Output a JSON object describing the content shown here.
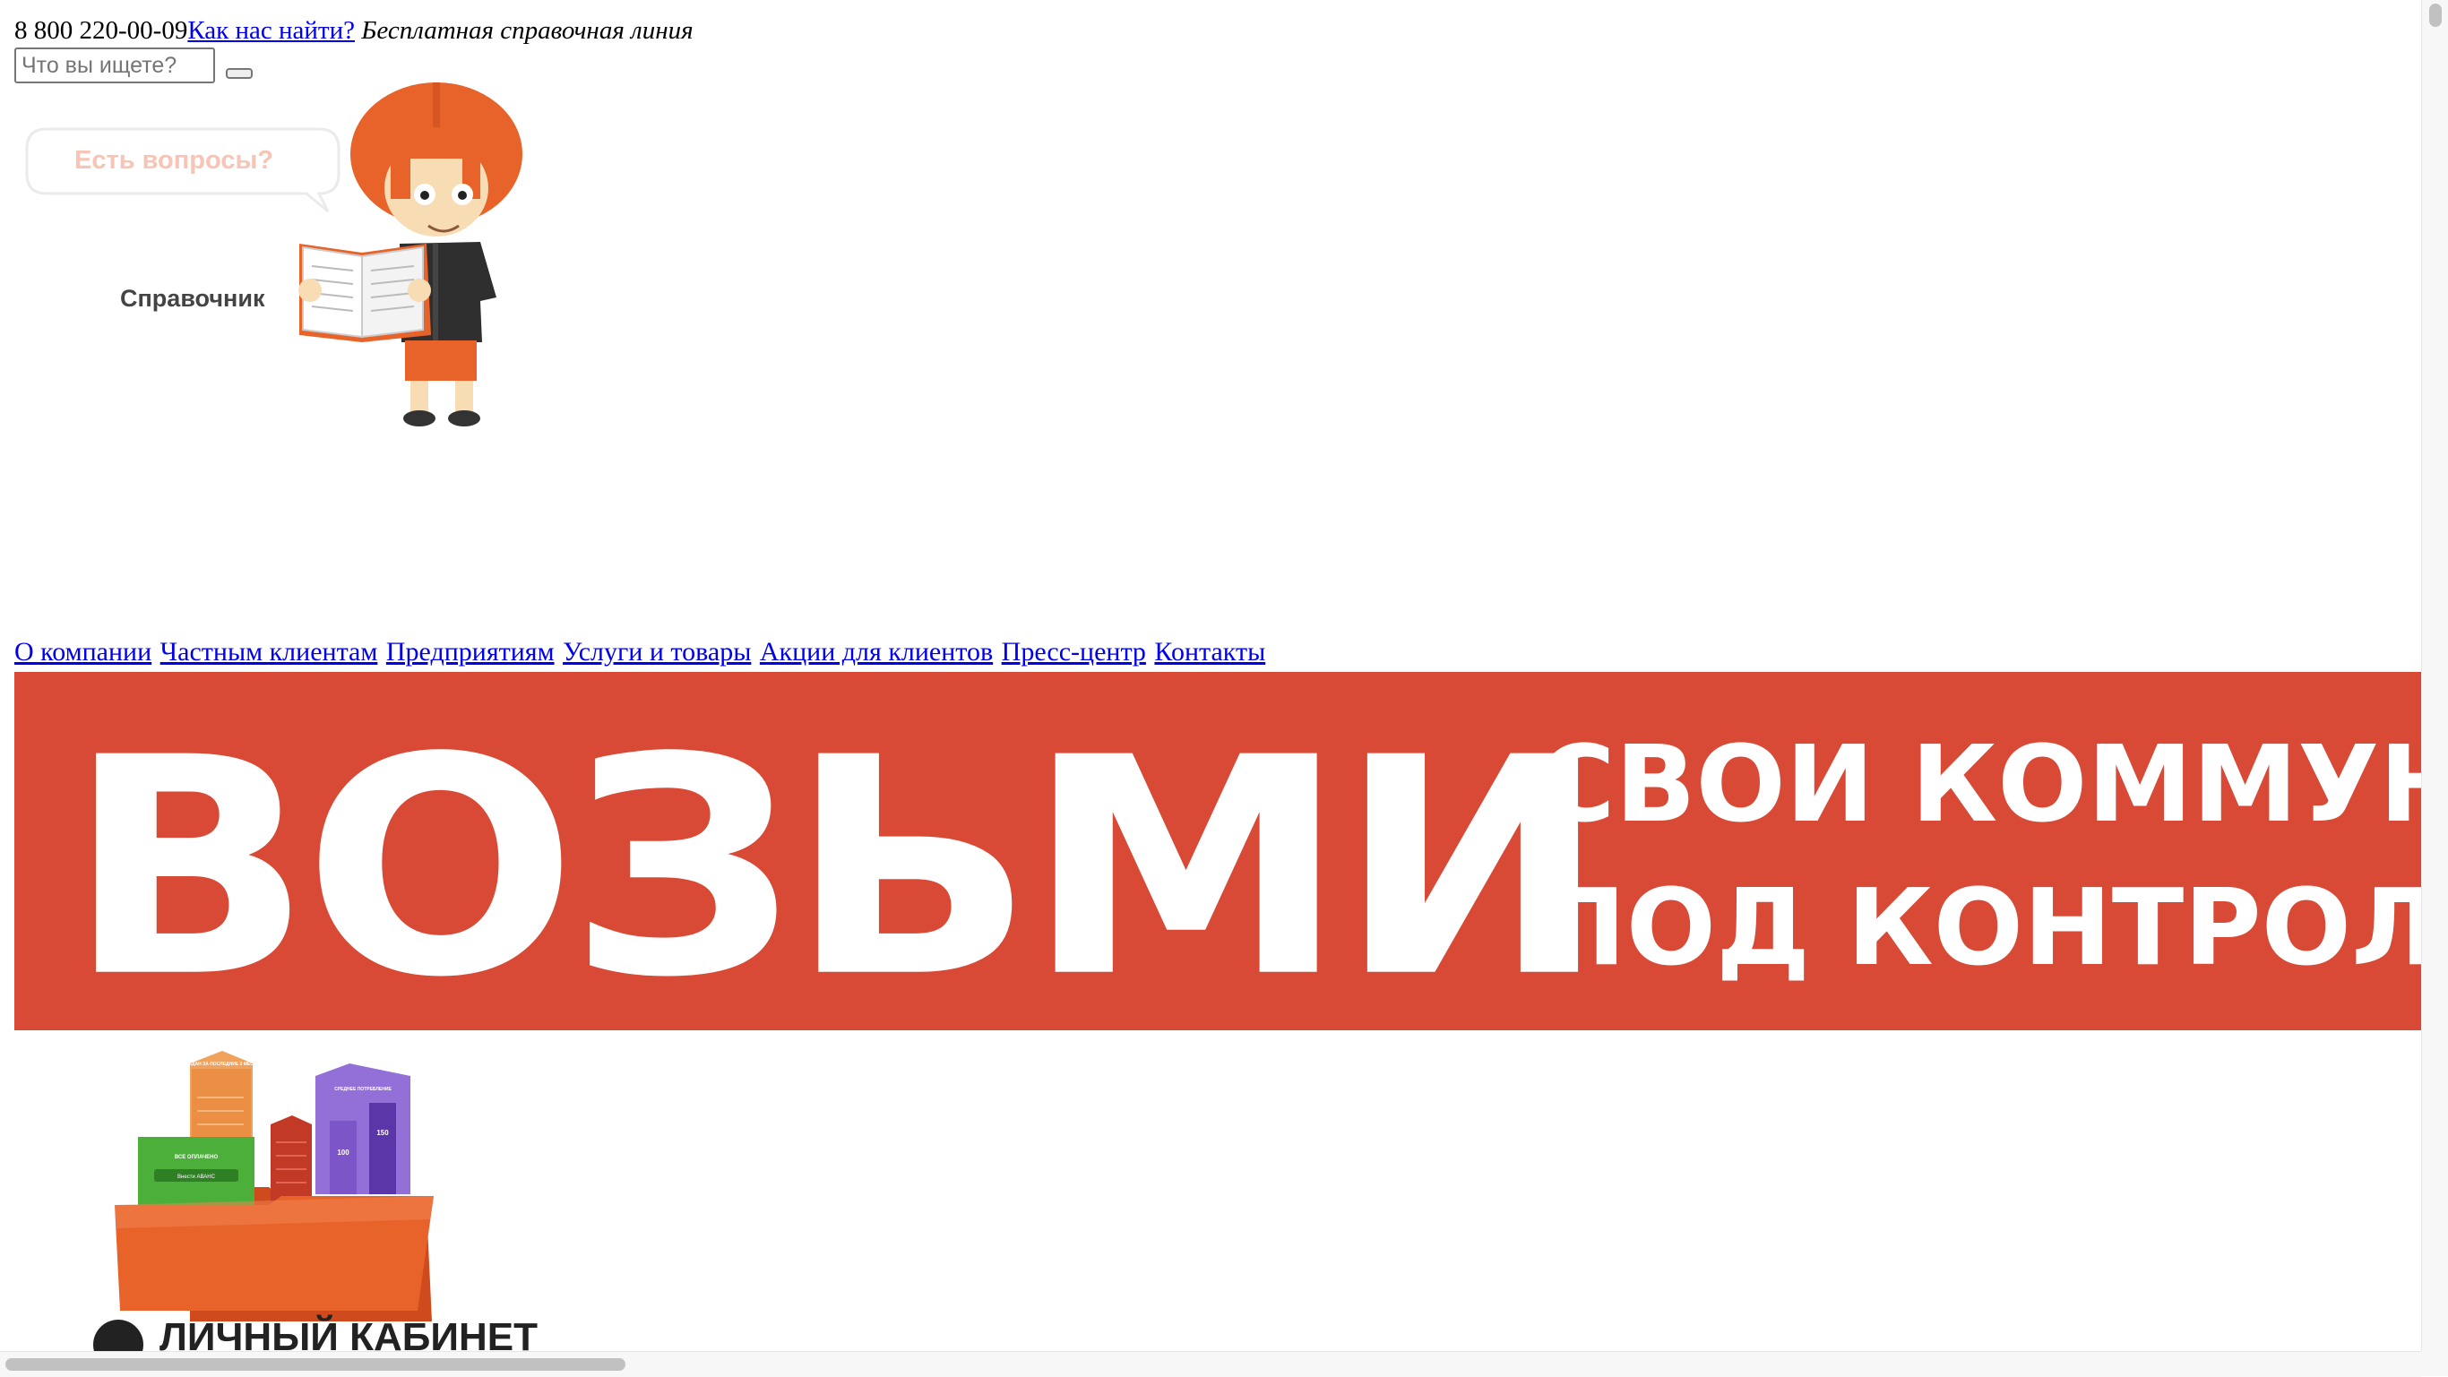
{
  "header": {
    "phone": "8 800 220-00-09",
    "find_us_link": "Как нас найти?",
    "hotline_label": "Бесплатная справочная линия"
  },
  "search": {
    "placeholder": "Что вы ищете?",
    "value": ""
  },
  "help_widget": {
    "bubble_text": "Есть вопросы?",
    "label": "Справочник"
  },
  "nav": {
    "items": [
      {
        "label": "О компании"
      },
      {
        "label": "Частным клиентам"
      },
      {
        "label": "Предприятиям"
      },
      {
        "label": "Услуги и товары"
      },
      {
        "label": "Акции для клиентов"
      },
      {
        "label": "Пресс-центр"
      },
      {
        "label": "Контакты"
      }
    ]
  },
  "banner": {
    "headline": "ВОЗЬМИ",
    "line1": "СВОИ КОММУНАЛ",
    "line2": "ПОД КОНТРОЛЬ!",
    "background_color": "#d94a36"
  },
  "cabinet": {
    "caption": "ЛИЧНЫЙ КАБИНЕТ",
    "green_card_title": "ВСЕ ОПЛАЧЕНО",
    "green_card_button": "Внести АВАНС",
    "orange_card_title": "ПЕРЕДАН ЗА ПОСЛЕДНИЕ 3 МЕСЯЦА",
    "purple_card_title": "СРЕДНЕЕ ПОТРЕБЛЕНИЕ",
    "purple_value_1": "100",
    "purple_value_2": "150"
  },
  "colors": {
    "link": "#0000ee",
    "accent_orange": "#e8632a",
    "banner_red": "#d94a36"
  },
  "icons": {
    "search_button": "search-icon",
    "mascot": "mascot-reader-icon",
    "folder": "folder-icon"
  }
}
